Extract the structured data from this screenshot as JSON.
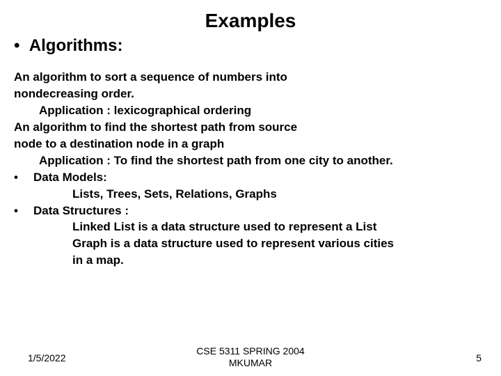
{
  "title": "Examples",
  "subhead_bullet": "•",
  "subhead": "Algorithms:",
  "lines": {
    "l1": "An algorithm to sort a sequence of numbers into",
    "l2": "nondecreasing order.",
    "l3": "Application : lexicographical ordering",
    "l4": "An algorithm to find the shortest path from source",
    "l5": "node to a destination node in a  graph",
    "l6": "Application : To find the shortest path from one city to another.",
    "b1_dot": "•",
    "b1": "Data Models:",
    "b1_sub": "Lists, Trees, Sets, Relations, Graphs",
    "b2_dot": "•",
    "b2": "Data Structures :",
    "b2_sub1": "Linked List is a data structure used to represent a List",
    "b2_sub2": "Graph is a data structure used to represent various cities",
    "b2_sub3": "in a map."
  },
  "footer": {
    "date": "1/5/2022",
    "course_line1": "CSE 5311 SPRING 2004",
    "course_line2": "MKUMAR",
    "page": "5"
  }
}
